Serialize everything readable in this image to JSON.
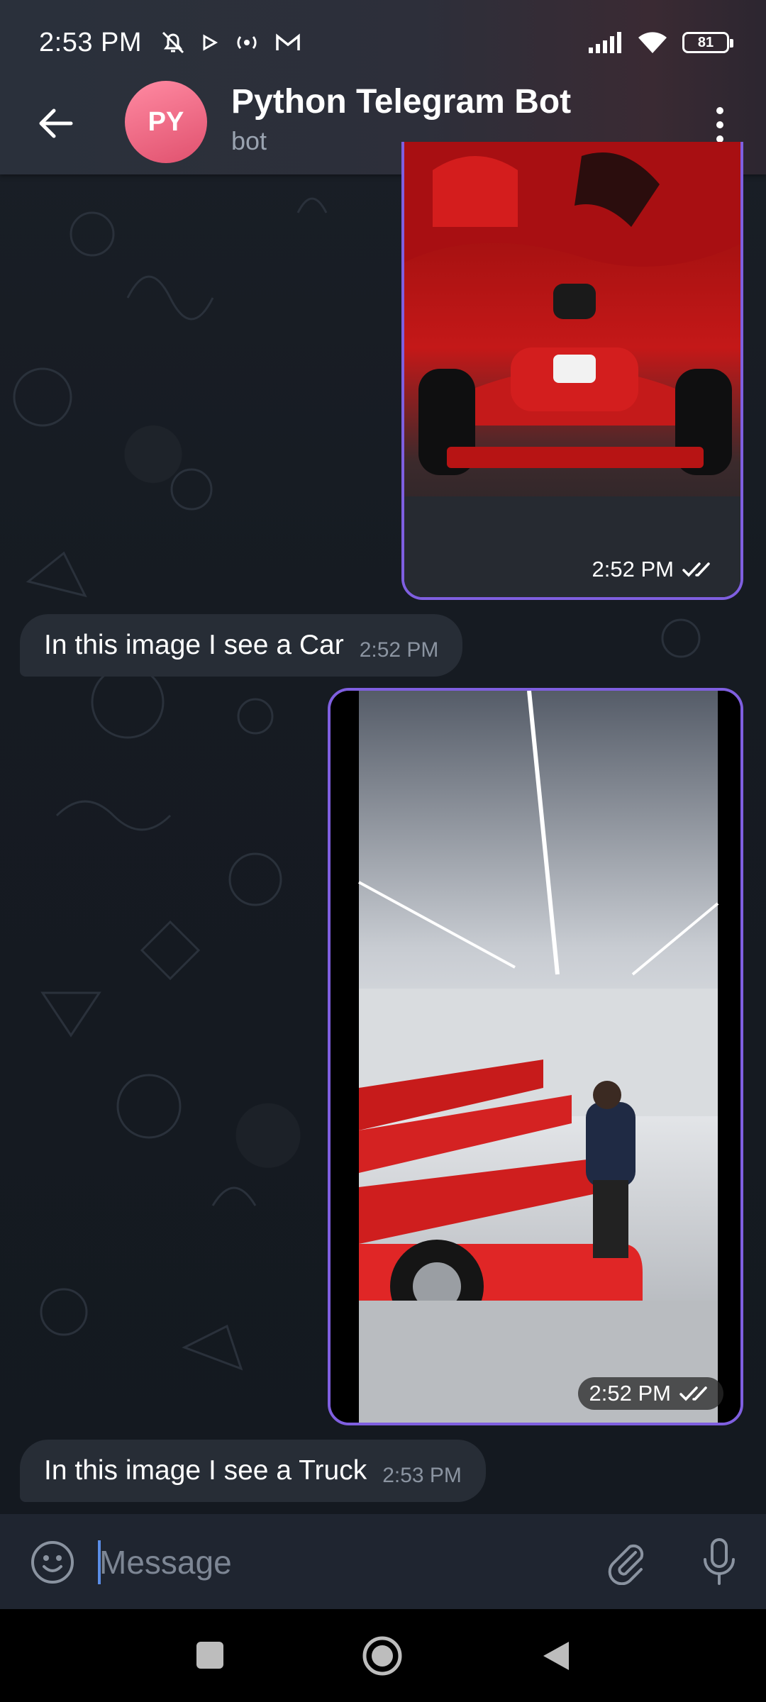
{
  "status_bar": {
    "time": "2:53 PM",
    "icons": [
      "bell-off-icon",
      "play-icon",
      "radio-icon",
      "gmail-icon"
    ],
    "right_icons": [
      "signal-icon",
      "wifi-icon",
      "battery-icon"
    ],
    "battery": "81"
  },
  "header": {
    "avatar_initials": "PY",
    "title": "Python Telegram Bot",
    "subtitle": "bot",
    "colors": {
      "avatar": "#e8607c"
    }
  },
  "messages": [
    {
      "type": "photo",
      "direction": "outgoing",
      "description_icon": "racing-car-photo",
      "time": "2:52 PM",
      "status": "read"
    },
    {
      "type": "text",
      "direction": "incoming",
      "text": "In this image I see a Car",
      "time": "2:52 PM"
    },
    {
      "type": "photo",
      "direction": "outgoing",
      "description_icon": "garage-cars-photo",
      "time": "2:52 PM",
      "status": "read"
    },
    {
      "type": "text",
      "direction": "incoming",
      "text": "In this image I see a Truck",
      "time": "2:53 PM"
    }
  ],
  "input": {
    "placeholder": "Message",
    "value": ""
  },
  "colors": {
    "photo_border": "#7f5fe0",
    "incoming_bubble": "#272d36",
    "cursor": "#5a8de6"
  }
}
